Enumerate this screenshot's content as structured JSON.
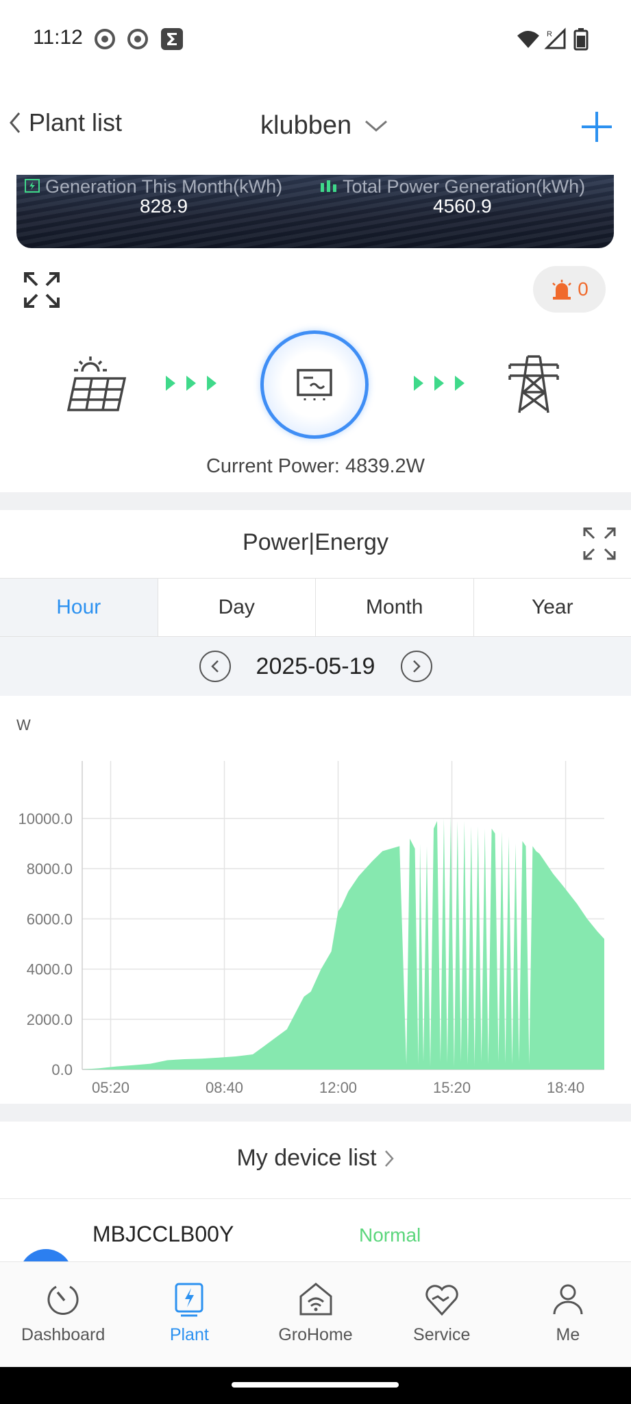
{
  "status_bar": {
    "time": "11:12"
  },
  "nav": {
    "back_label": "Plant list",
    "title": "klubben"
  },
  "banner": {
    "month_label": "Generation This Month(kWh)",
    "month_value": "828.9",
    "total_label": "Total Power Generation(kWh)",
    "total_value": "4560.9"
  },
  "alarm": {
    "count": "0"
  },
  "flow": {
    "current_power_label": "Current Power:",
    "current_power_value": "4839.2W"
  },
  "chart_card": {
    "title": "Power|Energy",
    "tabs": [
      "Hour",
      "Day",
      "Month",
      "Year"
    ],
    "active_tab": "Hour",
    "date": "2025-05-19"
  },
  "chart_data": {
    "type": "area",
    "ylabel": "W",
    "ylim": [
      0,
      10000
    ],
    "yticks": [
      "0.0",
      "2000.0",
      "4000.0",
      "6000.0",
      "8000.0",
      "10000.0"
    ],
    "xticks": [
      "05:20",
      "08:40",
      "12:00",
      "15:20",
      "18:40"
    ],
    "x_hours": [
      4.5,
      5.0,
      5.5,
      6.0,
      6.5,
      7.0,
      7.5,
      8.0,
      8.5,
      9.0,
      9.5,
      9.8,
      10.0,
      10.5,
      11.0,
      11.2,
      11.3,
      11.5,
      11.8,
      12.0,
      12.1,
      12.3,
      12.6,
      13.0,
      13.3,
      13.8,
      14.0,
      14.1,
      14.25,
      14.35,
      14.4,
      14.5,
      14.6,
      14.7,
      14.8,
      14.9,
      15.0,
      15.1,
      15.2,
      15.3,
      15.4,
      15.5,
      15.6,
      15.7,
      15.8,
      15.9,
      16.0,
      16.1,
      16.2,
      16.3,
      16.4,
      16.5,
      16.6,
      16.7,
      16.8,
      16.9,
      17.0,
      17.1,
      17.2,
      17.3,
      17.4,
      17.5,
      17.6,
      17.7,
      17.8,
      17.9,
      18.0,
      18.1,
      18.3,
      18.6,
      19.0,
      19.3,
      19.6,
      19.8
    ],
    "values": [
      0,
      50,
      120,
      170,
      230,
      370,
      410,
      430,
      470,
      520,
      600,
      900,
      1100,
      1600,
      2900,
      3100,
      3400,
      4000,
      4700,
      6300,
      6500,
      7100,
      7700,
      8300,
      8700,
      8900,
      200,
      9200,
      8800,
      200,
      9000,
      300,
      8900,
      100,
      9600,
      9900,
      300,
      10000,
      250,
      10100,
      100,
      9900,
      300,
      9900,
      200,
      9700,
      150,
      9700,
      300,
      9600,
      200,
      9600,
      9400,
      300,
      9500,
      250,
      9300,
      200,
      9000,
      300,
      9100,
      8900,
      200,
      8900,
      8700,
      8600,
      8400,
      8200,
      7800,
      7300,
      6600,
      6000,
      5500,
      5200
    ]
  },
  "device_list": {
    "title": "My device list",
    "device_name": "MBJCCLB00Y",
    "device_status": "Normal"
  },
  "bottom_nav": {
    "items": [
      "Dashboard",
      "Plant",
      "GroHome",
      "Service",
      "Me"
    ],
    "active": "Plant"
  },
  "colors": {
    "accent": "#2c91f0",
    "chart_fill": "#86e8af",
    "alarm": "#f06a2c",
    "status_normal": "#5bd67c"
  }
}
